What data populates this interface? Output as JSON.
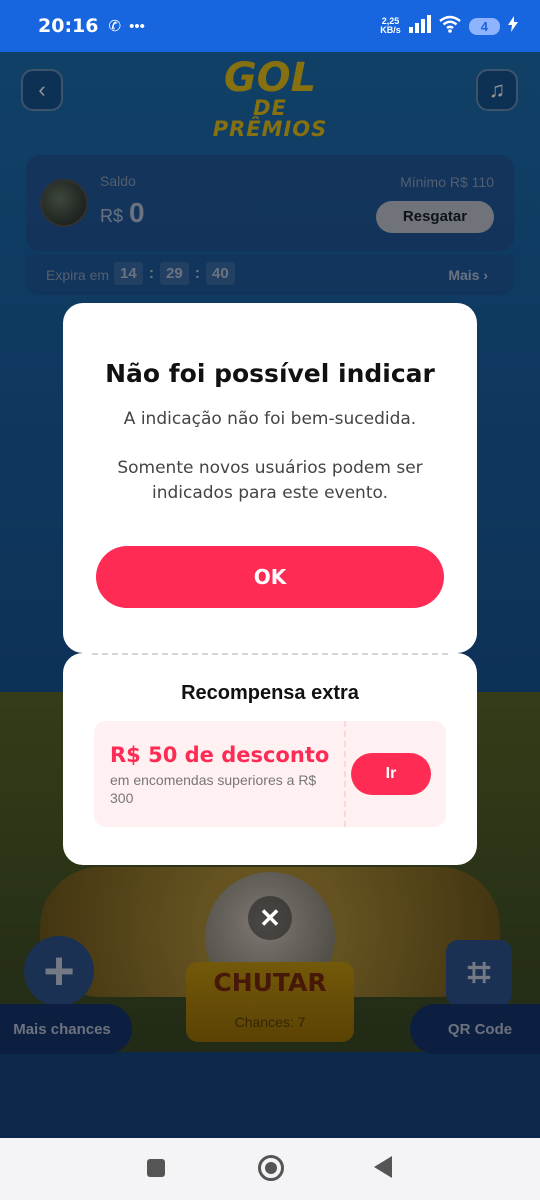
{
  "status_bar": {
    "time": "20:16",
    "net_speed_value": "2,25",
    "net_speed_unit": "KB/s",
    "battery": "4"
  },
  "game": {
    "logo_top": "GOL",
    "logo_bottom": "DE PRÊMIOS",
    "balance": {
      "label": "Saldo",
      "currency": "R$",
      "value": "0",
      "minimum": "Mínimo R$ 110",
      "redeem_button": "Resgatar"
    },
    "expiry": {
      "label": "Expira em",
      "hours": "14",
      "minutes": "29",
      "seconds": "40",
      "more": "Mais ›"
    },
    "kick_button": "CHUTAR",
    "chances": "Chances: 7",
    "more_chances_button": "Mais chances",
    "qr_button": "QR Code"
  },
  "dialog": {
    "title": "Não foi possível indicar",
    "message_1": "A indicação não foi bem-sucedida.",
    "message_2": "Somente novos usuários podem ser indicados para este evento.",
    "ok_button": "OK"
  },
  "reward": {
    "title": "Recompensa extra",
    "coupon_amount": "R$ 50 de desconto",
    "coupon_description": "em encomendas superiores a R$ 300",
    "go_button": "Ir"
  },
  "colors": {
    "accent": "#fe2c55",
    "status_bar": "#1766e0"
  }
}
